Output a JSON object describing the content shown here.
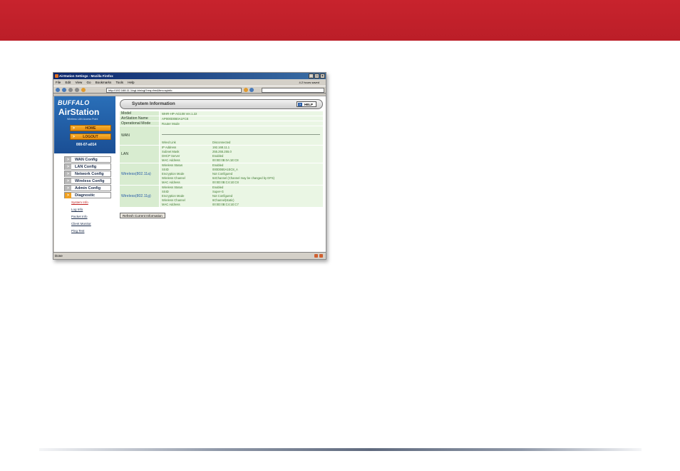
{
  "colors": {
    "banner": "#c8232d",
    "sidebar": "#1a4e94",
    "table_label": "#d8ecd0",
    "table_value": "#eaf6e4",
    "accent_orange": "#f0a020"
  },
  "browser": {
    "title": "AirStation Settings - Mozilla Firefox",
    "menu": [
      "File",
      "Edit",
      "View",
      "Go",
      "Bookmarks",
      "Tools",
      "Help"
    ],
    "menu_right": "4.2 hours saved",
    "url": "http://192.168.11.1/cgi-bin/cgi?req=frm&frm=syinfo",
    "status": "Done"
  },
  "sidebar": {
    "brand": "BUFFALO",
    "product": "AirStation",
    "tagline": "Wireless LAN Access Point",
    "home": "HOME",
    "logout": "LOGOUT",
    "ssid": "000-07-a014",
    "menu": [
      {
        "label": "WAN Config"
      },
      {
        "label": "LAN Config"
      },
      {
        "label": "Network Config"
      },
      {
        "label": "Wireless Config"
      },
      {
        "label": "Admin Config"
      },
      {
        "label": "Diagnostic"
      }
    ],
    "sublinks": [
      "System Info",
      "Log Info",
      "Packet Info",
      "Client Monitor",
      "Ping Test"
    ]
  },
  "main": {
    "title": "System Information",
    "help": "HELP",
    "model": {
      "label": "Model",
      "value": "WHR-HP-AG108 Ver.1.22"
    },
    "name": {
      "label": "AirStation Name",
      "value": "AP000D0B0A1FCE"
    },
    "mode": {
      "label": "Operational Mode",
      "value": "Router Mode"
    },
    "wan": {
      "label": "WAN",
      "rows": [
        {
          "k": "Wired Link",
          "v": "Disconnected"
        }
      ]
    },
    "lan": {
      "label": "LAN",
      "rows": [
        {
          "k": "IP Address",
          "v": "192.168.11.1"
        },
        {
          "k": "Subnet Mask",
          "v": "255.255.255.0"
        },
        {
          "k": "DHCP Server",
          "v": "Enabled"
        },
        {
          "k": "MAC Address",
          "v": "00:0D:0B:0A:1E:C8"
        }
      ]
    },
    "wa": {
      "label": "Wireless(802.11a)",
      "rows": [
        {
          "k": "Wireless Status",
          "v": "Enabled"
        },
        {
          "k": "SSID",
          "v": "000D0B0A1EC8_A"
        },
        {
          "k": "Encryption Mode",
          "v": "Not Configured"
        },
        {
          "k": "Wireless Channel",
          "v": "64Channel (Channel may be changed by DFS)"
        },
        {
          "k": "MAC Address",
          "v": "00:0D:0B:C4:1E:C8"
        }
      ]
    },
    "wg": {
      "label": "Wireless(802.11g)",
      "rows": [
        {
          "k": "Wireless Status",
          "v": "Enabled"
        },
        {
          "k": "SSID",
          "v": "Super-G"
        },
        {
          "k": "Encryption Mode",
          "v": "Not Configured"
        },
        {
          "k": "Wireless Channel",
          "v": "6Channel(static)"
        },
        {
          "k": "MAC Address",
          "v": "00:0D:0B:C4:1E:C7"
        }
      ]
    },
    "refresh": "Refresh Current Information"
  }
}
